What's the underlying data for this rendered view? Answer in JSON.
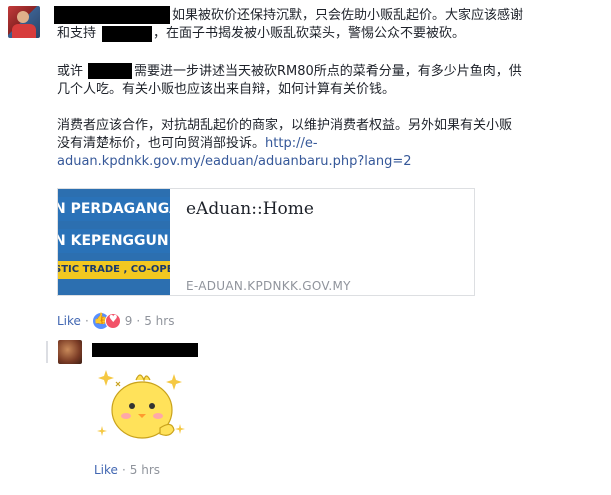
{
  "comment": {
    "lines": [
      "如果被砍价还保持沉默，只会佐助小贩乱起价。大家应该感谢",
      "和支持",
      "，在面子书揭发被小贩乱砍菜头，警惕公众不要被砍。",
      "或许",
      "需要进一步讲述当天被砍RM80所点的菜肴分量，有多少片鱼肉，供",
      "几个人吃。有关小贩也应该出来自辩，如何计算有关价钱。",
      "消费者应该合作，对抗胡乱起价的商家，以维护消费者权益。另外如果有关小贩",
      "没有清楚标价，也可向贸消部投诉。",
      "http://e-",
      "aduan.kpdnkk.gov.my/eaduan/aduanbaru.php?lang=2"
    ],
    "preview": {
      "title": "eAduan::Home",
      "domain": "E-ADUAN.KPDNKK.GOV.MY",
      "image_text": [
        "N PERDAGANGA",
        "N KEPENGGUN",
        "STIC TRADE , CO-OPERAT"
      ]
    },
    "actions": {
      "like": "Like",
      "count": "9",
      "time": "5 hrs",
      "sep": "·"
    }
  },
  "reply": {
    "actions": {
      "like": "Like",
      "time": "5 hrs",
      "sep": "·"
    },
    "sticker_icon": "chick-sticker-icon"
  },
  "colors": {
    "link": "#365899",
    "like": "#4267b2",
    "meta": "#90949c"
  }
}
